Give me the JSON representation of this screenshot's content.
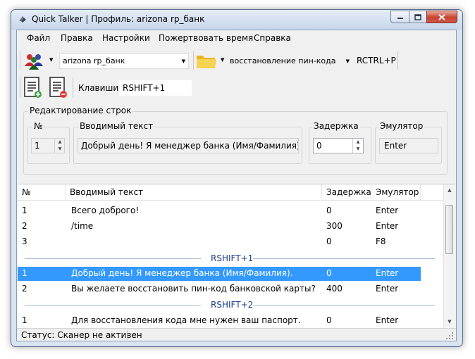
{
  "window": {
    "title": "Quick Talker | Профиль: arizona rp_банк"
  },
  "menu": [
    "Файл",
    "Правка",
    "Настройки",
    "Пожертвовать время",
    "Справка"
  ],
  "toolbar": {
    "profile_value": "arizona rp_банк",
    "category_value": "восстановление пин-кода",
    "category_hotkey": "RCTRL+P",
    "keys_label": "Клавиши:",
    "keys_value": "RSHIFT+1"
  },
  "edit": {
    "group_title": "Редактирование строк",
    "number_label": "№",
    "number_value": "1",
    "text_label": "Вводимый текст",
    "text_value": "Добрый день! Я менеджер банка (Имя/Фамилия).",
    "delay_label": "Задержка",
    "delay_value": "0",
    "emulator_label": "Эмулятор",
    "emulator_value": "Enter"
  },
  "list": {
    "headers": [
      "№",
      "Вводимый текст",
      "Задержка",
      "Эмулятор"
    ],
    "rows_group0": [
      {
        "n": "1",
        "text": "Всего доброго!",
        "delay": "0",
        "emu": "Enter"
      },
      {
        "n": "2",
        "text": "/time",
        "delay": "300",
        "emu": "Enter"
      },
      {
        "n": "3",
        "text": "",
        "delay": "0",
        "emu": "F8"
      }
    ],
    "group1": "RSHIFT+1",
    "rows_group1": [
      {
        "n": "1",
        "text": "Добрый день! Я менеджер банка (Имя/Фамилия).",
        "delay": "0",
        "emu": "Enter"
      },
      {
        "n": "2",
        "text": "Вы желаете восстановить пин-код банковской карты?",
        "delay": "400",
        "emu": "Enter"
      }
    ],
    "group2": "RSHIFT+2",
    "rows_group2": [
      {
        "n": "1",
        "text": "Для восстановления кода мне нужен ваш паспорт.",
        "delay": "0",
        "emu": "Enter"
      }
    ],
    "selected_row": "rows_group1.0"
  },
  "status": {
    "text": "Статус: Сканер не активен"
  },
  "colors": {
    "selection": "#3399ff",
    "group_text": "#1e3f8a"
  }
}
